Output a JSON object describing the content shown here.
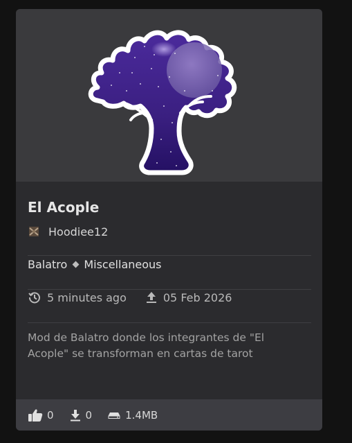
{
  "mod": {
    "title": "El Acople",
    "author": "Hoodiee12",
    "game": "Balatro",
    "category": "Miscellaneous",
    "updated": "5 minutes ago",
    "uploaded": "05 Feb 2026",
    "description": "Mod de Balatro donde los integrantes de \"El Acople\" se transforman en cartas de tarot"
  },
  "stats": {
    "likes": "0",
    "downloads": "0",
    "size": "1.4MB"
  },
  "icons": {
    "updated": "history-icon",
    "uploaded": "upload-icon",
    "likes": "thumbs-up-icon",
    "downloads": "download-icon",
    "size": "storage-icon"
  },
  "colors": {
    "card": "#2b2b2e",
    "thumbnail_bg": "#3a3a3d",
    "footer": "#3d3d42",
    "tree_purple": "#3a1f80"
  }
}
